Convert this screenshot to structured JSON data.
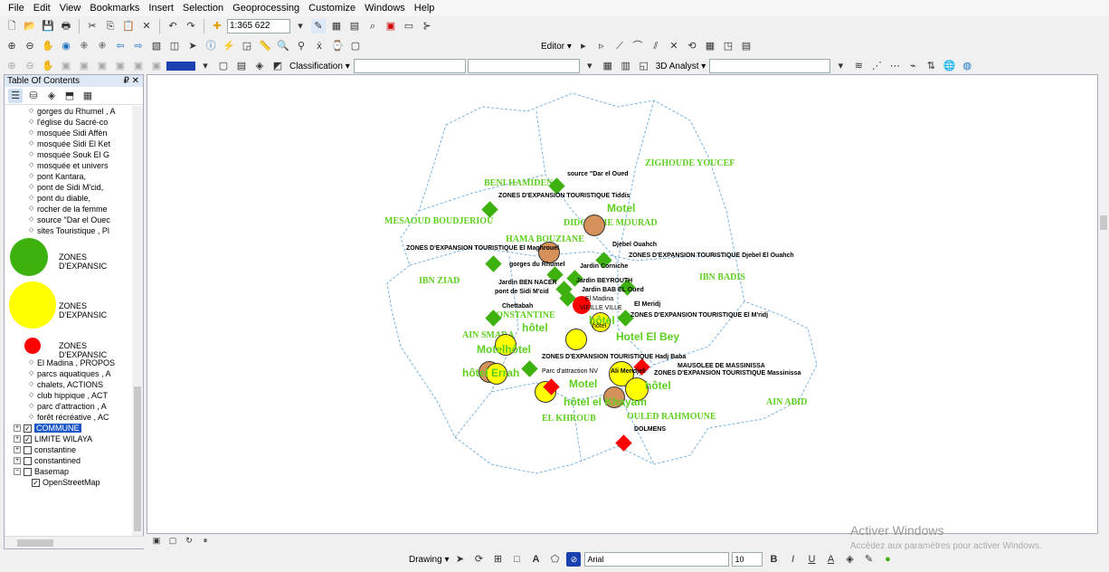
{
  "menu": [
    "File",
    "Edit",
    "View",
    "Bookmarks",
    "Insert",
    "Selection",
    "Geoprocessing",
    "Customize",
    "Windows",
    "Help"
  ],
  "toolbar": {
    "scale": "1:365 622",
    "editor_label": "Editor ▾",
    "classification_label": "Classification ▾",
    "analyst_label": "3D Analyst ▾"
  },
  "toc": {
    "title": "Table Of Contents",
    "pin": "₽ ✕",
    "items_top": [
      "gorges du Rhumel , A",
      "l'église du Sacré-co",
      "mosquée Sidi Affèn",
      "mosquée Sidi El Ket",
      "mosquée Souk El G",
      "mosquée et univers",
      "pont Kantara,",
      "pont de Sidi M'cid,",
      "pont du diable,",
      "rocher de la femme",
      "source \"Dar el Ouec",
      "sites Touristique , Pl"
    ],
    "legend": [
      {
        "label": "ZONES D'EXPANSIC",
        "color": "#3db10e"
      },
      {
        "label": "ZONES D'EXPANSIC",
        "color": "#ffff00"
      },
      {
        "label": "ZONES D'EXPANSIC",
        "color": "#ff0000"
      }
    ],
    "items_bottom": [
      "El Madina , PROPOS",
      "parcs aquatiques , A",
      "chalets, ACTIONS",
      "club hippique , ACT",
      "parc d'attraction , A",
      "forêt récréative , AC"
    ],
    "layers": [
      {
        "label": "COMMUNE",
        "checked": true,
        "selected": true
      },
      {
        "label": "LIMITE WILAYA",
        "checked": true,
        "selected": false
      },
      {
        "label": "constantine",
        "checked": false,
        "selected": false
      },
      {
        "label": "constantined",
        "checked": false,
        "selected": false
      },
      {
        "label": "Basemap",
        "checked": false,
        "selected": false
      }
    ],
    "sublayer": "OpenStreetMap"
  },
  "map": {
    "communes": [
      "ZIGHOUDE YOUCEF",
      "BENI HAMIDEN",
      "MESAOUD BOUDJERIOU",
      "DIDOUCHE MOURAD",
      "HAMA BOUZIANE",
      "IBN ZIAD",
      "IBN BADIS",
      "CONSTANTINE",
      "AIN SMARA",
      "EL KHROUB",
      "OULED RAHMOUNE",
      "AIN ABID"
    ],
    "labels": [
      "source \"Dar el Oued",
      "ZONES D'EXPANSION TOURISTIQUE Tiddis",
      "Motel",
      "Djebel Ouahch",
      "ZONES D'EXPANSION TOURISTIQUE El Maghrouel",
      "ZONES D'EXPANSION TOURISTIQUE Djebel El Ouahch",
      "gorges du Rhumel",
      "Jardin Corniche",
      "Jardin BEN NACER",
      "Jardin BEYROUTH",
      "pont de Sidi M'cid",
      "Jardin BAB EL Oued",
      "El Madina",
      "El Meridj",
      "Chettabah",
      "VIEILLE VILLE",
      "ZONES D'EXPANSION TOURISTIQUE El M'ridj",
      "hôtel",
      "hôtel",
      "Hotel El Bey",
      "Motelhôtel",
      "ZONES D'EXPANSION TOURISTIQUE Hadj Baba",
      "MAUSOLEE DE MASSINISSA",
      "hôtel Errah",
      "Parc d'attraction NV",
      "Ali Mendjeli",
      "ZONES D'EXPANSION TOURISTIQUE Massinissa",
      "Motel",
      "hôtel",
      "hôtel el Khayam",
      "DOLMENS",
      "hôtel"
    ]
  },
  "watermark": {
    "line1": "Activer Windows",
    "line2": "Accédez aux paramètres pour activer Windows."
  },
  "drawing": {
    "label": "Drawing ▾",
    "font": "Arial",
    "size": "10"
  }
}
